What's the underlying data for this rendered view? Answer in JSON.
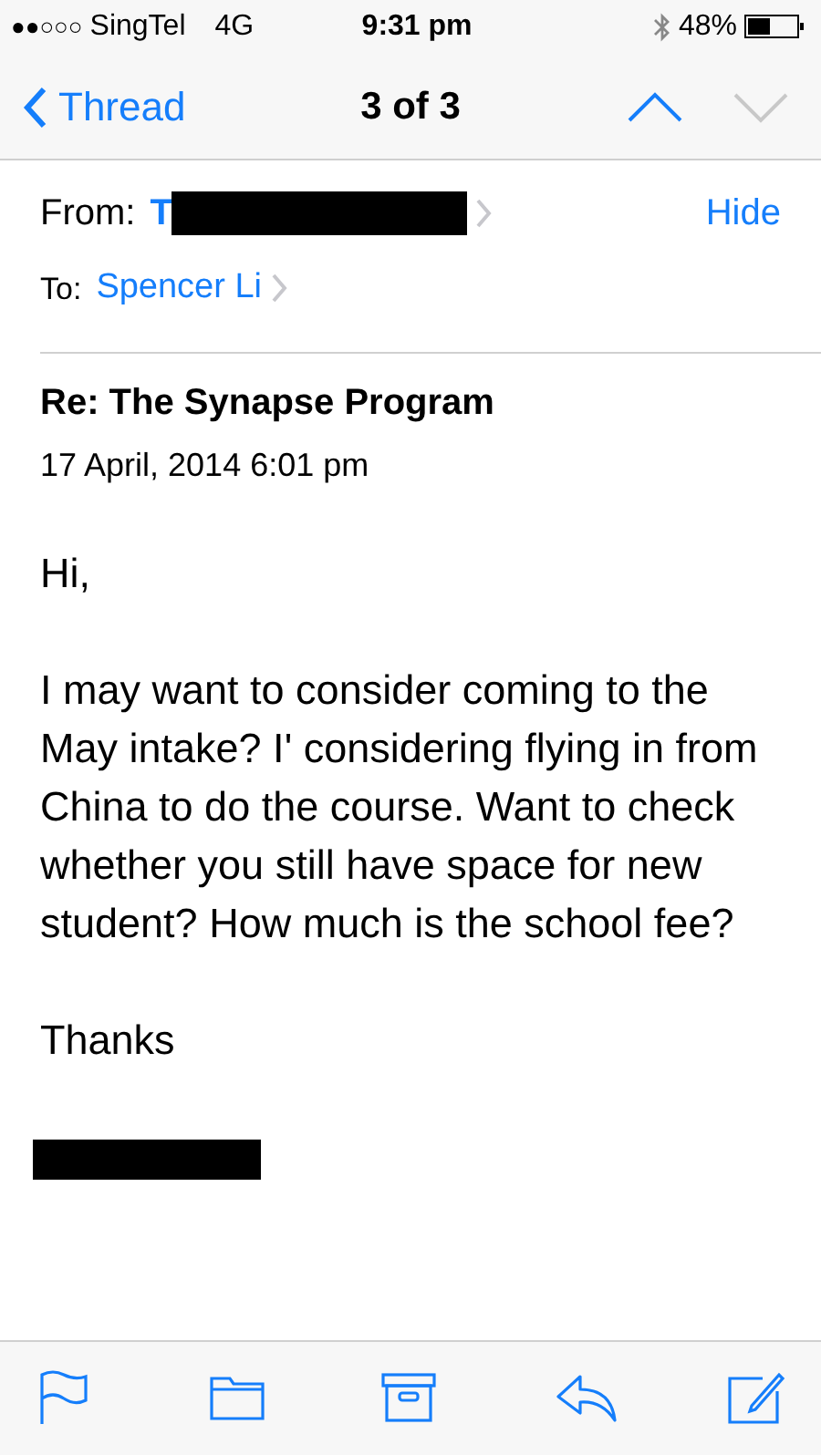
{
  "status_bar": {
    "signal_text": "●●○○○",
    "carrier": "SingTel",
    "network": "4G",
    "time": "9:31 pm",
    "battery": "48%"
  },
  "nav": {
    "back": "Thread",
    "title": "3 of 3",
    "previous": {
      "disabled": false
    },
    "next": {
      "disabled": true
    }
  },
  "header": {
    "from_label": "From:",
    "from_name": "T",
    "from_redacted": true,
    "hide": "Hide",
    "to_label": "To:",
    "to_name": "Spencer Li"
  },
  "subject": "Re: The Synapse Program",
  "date": "17 April, 2014 6:01 pm",
  "body": [
    "Hi,",
    "I may want to consider coming to the May intake? I' considering flying in from China to do the course. Want to check whether you still have space for new student? How much is the school fee?",
    "Thanks"
  ],
  "signature": {
    "redacted": true
  },
  "toolbar": [
    {
      "kind": "flag"
    },
    {
      "kind": "folder"
    },
    {
      "kind": "archive"
    },
    {
      "kind": "reply"
    },
    {
      "kind": "compose"
    }
  ]
}
